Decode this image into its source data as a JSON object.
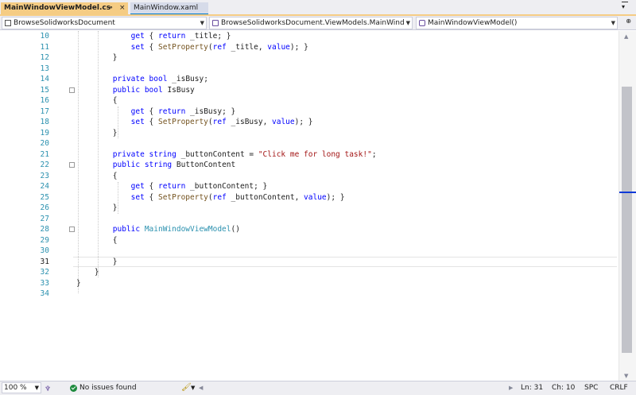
{
  "tabs": [
    {
      "label": "MainWindowViewModel.cs",
      "active": true,
      "pin_glyph": "⊸",
      "close_glyph": "×"
    },
    {
      "label": "MainWindow.xaml",
      "active": false
    }
  ],
  "navbar": {
    "project": "BrowseSolidworksDocument",
    "class": "BrowseSolidworksDocument.ViewModels.MainWind",
    "member": "MainWindowViewModel()"
  },
  "editor": {
    "current_line": 31,
    "lines": [
      {
        "num": "10",
        "tokens": [
          {
            "t": "            ",
            "c": "pl"
          },
          {
            "t": "get",
            "c": "kw"
          },
          {
            "t": " { ",
            "c": "pl"
          },
          {
            "t": "return",
            "c": "kw"
          },
          {
            "t": " _title; }",
            "c": "pl"
          }
        ]
      },
      {
        "num": "11",
        "tokens": [
          {
            "t": "            ",
            "c": "pl"
          },
          {
            "t": "set",
            "c": "kw"
          },
          {
            "t": " { ",
            "c": "pl"
          },
          {
            "t": "SetProperty",
            "c": "mt"
          },
          {
            "t": "(",
            "c": "pl"
          },
          {
            "t": "ref",
            "c": "kw"
          },
          {
            "t": " _title, ",
            "c": "pl"
          },
          {
            "t": "value",
            "c": "kw"
          },
          {
            "t": "); }",
            "c": "pl"
          }
        ]
      },
      {
        "num": "12",
        "tokens": [
          {
            "t": "        }",
            "c": "pl"
          }
        ]
      },
      {
        "num": "13",
        "tokens": []
      },
      {
        "num": "14",
        "tokens": [
          {
            "t": "        ",
            "c": "pl"
          },
          {
            "t": "private",
            "c": "kw"
          },
          {
            "t": " ",
            "c": "pl"
          },
          {
            "t": "bool",
            "c": "kw"
          },
          {
            "t": " _isBusy;",
            "c": "pl"
          }
        ]
      },
      {
        "num": "15",
        "fold": true,
        "tokens": [
          {
            "t": "        ",
            "c": "pl"
          },
          {
            "t": "public",
            "c": "kw"
          },
          {
            "t": " ",
            "c": "pl"
          },
          {
            "t": "bool",
            "c": "kw"
          },
          {
            "t": " IsBusy",
            "c": "pl"
          }
        ]
      },
      {
        "num": "16",
        "tokens": [
          {
            "t": "        {",
            "c": "pl"
          }
        ]
      },
      {
        "num": "17",
        "tokens": [
          {
            "t": "            ",
            "c": "pl"
          },
          {
            "t": "get",
            "c": "kw"
          },
          {
            "t": " { ",
            "c": "pl"
          },
          {
            "t": "return",
            "c": "kw"
          },
          {
            "t": " _isBusy; }",
            "c": "pl"
          }
        ]
      },
      {
        "num": "18",
        "tokens": [
          {
            "t": "            ",
            "c": "pl"
          },
          {
            "t": "set",
            "c": "kw"
          },
          {
            "t": " { ",
            "c": "pl"
          },
          {
            "t": "SetProperty",
            "c": "mt"
          },
          {
            "t": "(",
            "c": "pl"
          },
          {
            "t": "ref",
            "c": "kw"
          },
          {
            "t": " _isBusy, ",
            "c": "pl"
          },
          {
            "t": "value",
            "c": "kw"
          },
          {
            "t": "); }",
            "c": "pl"
          }
        ]
      },
      {
        "num": "19",
        "tokens": [
          {
            "t": "        }",
            "c": "pl"
          }
        ]
      },
      {
        "num": "20",
        "tokens": []
      },
      {
        "num": "21",
        "tokens": [
          {
            "t": "        ",
            "c": "pl"
          },
          {
            "t": "private",
            "c": "kw"
          },
          {
            "t": " ",
            "c": "pl"
          },
          {
            "t": "string",
            "c": "kw"
          },
          {
            "t": " _buttonContent = ",
            "c": "pl"
          },
          {
            "t": "\"Click me for long task!\"",
            "c": "st"
          },
          {
            "t": ";",
            "c": "pl"
          }
        ]
      },
      {
        "num": "22",
        "fold": true,
        "tokens": [
          {
            "t": "        ",
            "c": "pl"
          },
          {
            "t": "public",
            "c": "kw"
          },
          {
            "t": " ",
            "c": "pl"
          },
          {
            "t": "string",
            "c": "kw"
          },
          {
            "t": " ButtonContent",
            "c": "pl"
          }
        ]
      },
      {
        "num": "23",
        "tokens": [
          {
            "t": "        {",
            "c": "pl"
          }
        ]
      },
      {
        "num": "24",
        "tokens": [
          {
            "t": "            ",
            "c": "pl"
          },
          {
            "t": "get",
            "c": "kw"
          },
          {
            "t": " { ",
            "c": "pl"
          },
          {
            "t": "return",
            "c": "kw"
          },
          {
            "t": " _buttonContent; }",
            "c": "pl"
          }
        ]
      },
      {
        "num": "25",
        "tokens": [
          {
            "t": "            ",
            "c": "pl"
          },
          {
            "t": "set",
            "c": "kw"
          },
          {
            "t": " { ",
            "c": "pl"
          },
          {
            "t": "SetProperty",
            "c": "mt"
          },
          {
            "t": "(",
            "c": "pl"
          },
          {
            "t": "ref",
            "c": "kw"
          },
          {
            "t": " _buttonContent, ",
            "c": "pl"
          },
          {
            "t": "value",
            "c": "kw"
          },
          {
            "t": "); }",
            "c": "pl"
          }
        ]
      },
      {
        "num": "26",
        "tokens": [
          {
            "t": "        }",
            "c": "pl"
          }
        ]
      },
      {
        "num": "27",
        "tokens": []
      },
      {
        "num": "28",
        "fold": true,
        "tokens": [
          {
            "t": "        ",
            "c": "pl"
          },
          {
            "t": "public",
            "c": "kw"
          },
          {
            "t": " ",
            "c": "pl"
          },
          {
            "t": "MainWindowViewModel",
            "c": "ty"
          },
          {
            "t": "()",
            "c": "pl"
          }
        ]
      },
      {
        "num": "29",
        "tokens": [
          {
            "t": "        {",
            "c": "pl"
          }
        ]
      },
      {
        "num": "30",
        "tokens": []
      },
      {
        "num": "31",
        "tokens": [
          {
            "t": "        }",
            "c": "pl"
          }
        ]
      },
      {
        "num": "32",
        "tokens": [
          {
            "t": "    }",
            "c": "pl"
          }
        ]
      },
      {
        "num": "33",
        "tokens": [
          {
            "t": "}",
            "c": "pl"
          }
        ]
      },
      {
        "num": "34",
        "tokens": []
      }
    ]
  },
  "status": {
    "zoom": "100 %",
    "issues": "No issues found",
    "line": "Ln: 31",
    "col": "Ch: 10",
    "spc": "SPC",
    "eol": "CRLF"
  },
  "colors": {
    "keyword": "#0000ff",
    "type": "#2b91af",
    "string": "#a31515",
    "method": "#74531f",
    "line_number": "#2b91af",
    "active_tab": "#f5cc84"
  }
}
